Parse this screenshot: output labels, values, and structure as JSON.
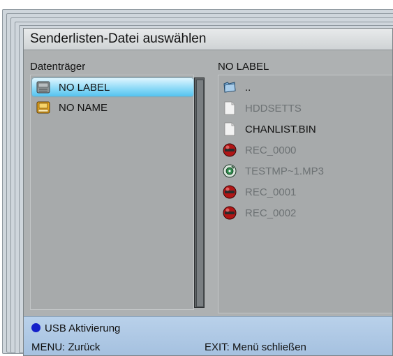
{
  "window": {
    "title": "Senderlisten-Datei auswählen"
  },
  "left_panel": {
    "header": "Datenträger",
    "items": [
      {
        "label": "NO LABEL",
        "icon": "usb-drive-icon",
        "selected": true
      },
      {
        "label": "NO NAME",
        "icon": "drive-yellow-icon",
        "selected": false
      }
    ]
  },
  "right_panel": {
    "header": "NO LABEL",
    "items": [
      {
        "label": "..",
        "icon": "folder-icon",
        "dim": false
      },
      {
        "label": "HDDSETTS",
        "icon": "document-icon",
        "dim": true
      },
      {
        "label": "CHANLIST.BIN",
        "icon": "document-icon",
        "dim": false
      },
      {
        "label": "REC_0000",
        "icon": "recording-icon",
        "dim": true
      },
      {
        "label": "TESTMP~1.MP3",
        "icon": "audio-cd-icon",
        "dim": true
      },
      {
        "label": "REC_0001",
        "icon": "recording-icon",
        "dim": true
      },
      {
        "label": "REC_0002",
        "icon": "recording-icon",
        "dim": true
      }
    ]
  },
  "footer": {
    "usb_label": "USB Aktivierung",
    "menu_hint": "MENU: Zurück",
    "exit_hint": "EXIT: Menü schließen",
    "dot_color": "#1420c9"
  }
}
